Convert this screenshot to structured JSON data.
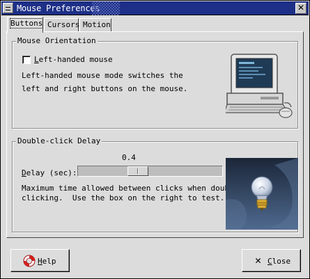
{
  "window": {
    "title": "Mouse Preferences",
    "close_glyph": "✕"
  },
  "tabs": [
    {
      "label": "Buttons",
      "active": true
    },
    {
      "label": "Cursors",
      "active": false
    },
    {
      "label": "Motion",
      "active": false
    }
  ],
  "orientation": {
    "frame_label": "Mouse Orientation",
    "checkbox_label": "Left-handed mouse",
    "checked": false,
    "description_line1": "Left-handed mouse mode switches the",
    "description_line2": "left and right buttons on the mouse.",
    "illustration_icon": "computer-mouse-icon"
  },
  "double_click": {
    "frame_label": "Double-click Delay",
    "value_label": "0.4",
    "delay_label": "Delay (sec):",
    "slider_fraction": 0.4,
    "description_line1": "Maximum time allowed between clicks when double-",
    "description_line2": "clicking.  Use the box on the right to test.",
    "test_icon": "lightbulb-icon"
  },
  "buttons": {
    "help_label": "Help",
    "close_label": "Close"
  },
  "colors": {
    "titlebar": "#1d2f87",
    "window_bg": "#dcdcdc",
    "test_box_bg": "#2e4060"
  }
}
